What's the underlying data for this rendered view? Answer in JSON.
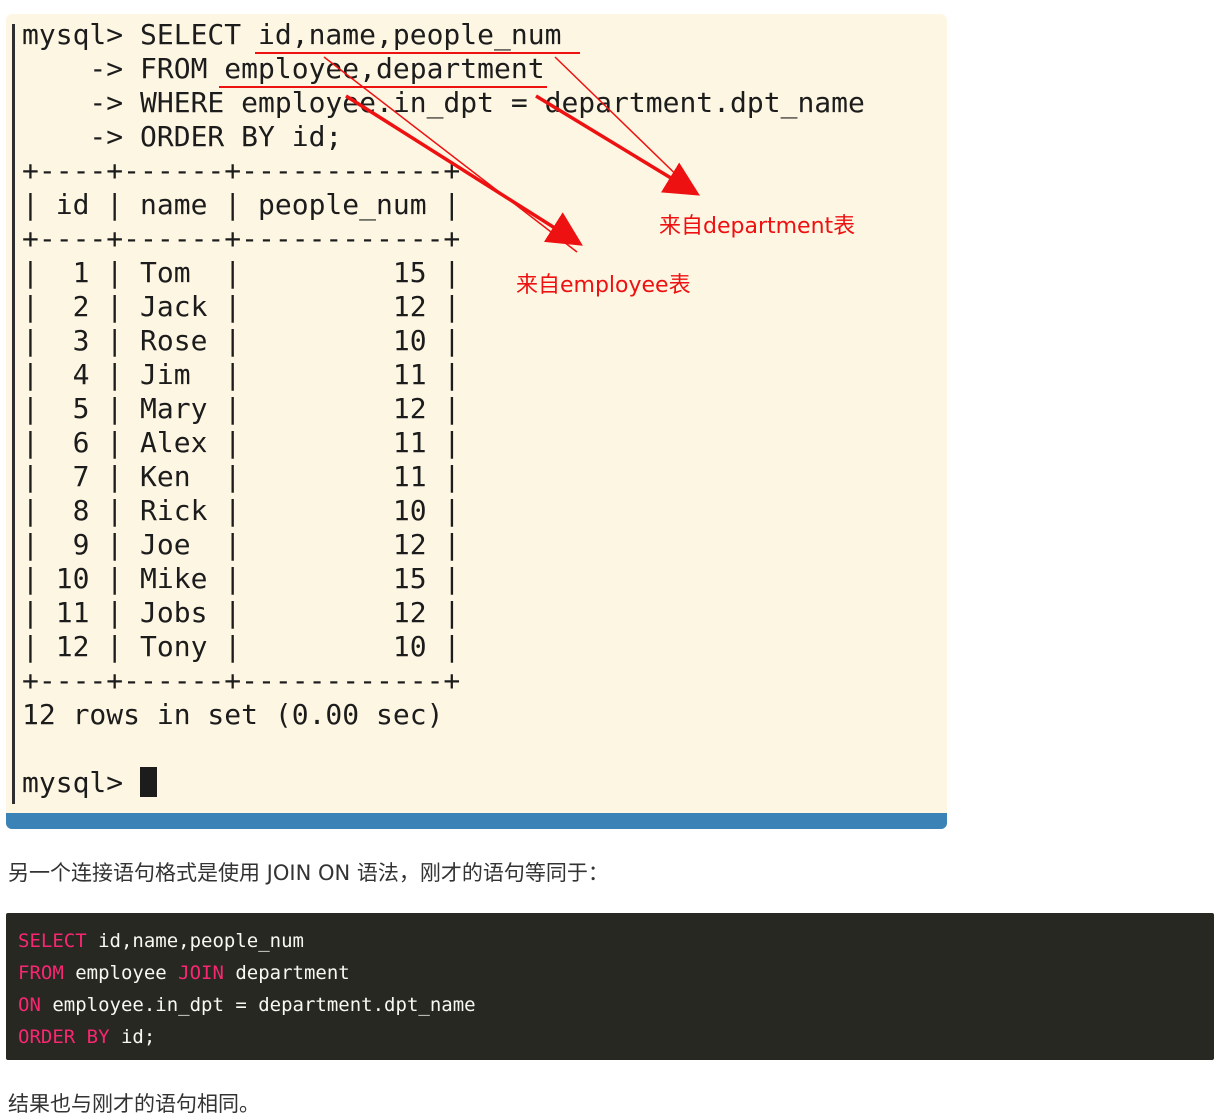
{
  "terminal": {
    "sql_lines": [
      "mysql> SELECT id,name,people_num",
      "    -> FROM employee,department",
      "    -> WHERE employee.in_dpt = department.dpt_name",
      "    -> ORDER BY id;"
    ],
    "table_border": "+----+------+------------+",
    "table_header": "| id | name | people_num |",
    "table_rows": [
      {
        "id": "1",
        "name": "Tom",
        "people_num": "15"
      },
      {
        "id": "2",
        "name": "Jack",
        "people_num": "12"
      },
      {
        "id": "3",
        "name": "Rose",
        "people_num": "10"
      },
      {
        "id": "4",
        "name": "Jim",
        "people_num": "11"
      },
      {
        "id": "5",
        "name": "Mary",
        "people_num": "12"
      },
      {
        "id": "6",
        "name": "Alex",
        "people_num": "11"
      },
      {
        "id": "7",
        "name": "Ken",
        "people_num": "11"
      },
      {
        "id": "8",
        "name": "Rick",
        "people_num": "10"
      },
      {
        "id": "9",
        "name": "Joe",
        "people_num": "12"
      },
      {
        "id": "10",
        "name": "Mike",
        "people_num": "15"
      },
      {
        "id": "11",
        "name": "Jobs",
        "people_num": "12"
      },
      {
        "id": "12",
        "name": "Tony",
        "people_num": "10"
      }
    ],
    "result_summary": "12 rows in set (0.00 sec)",
    "prompt": "mysql> ",
    "background_color": "#fdf6e3",
    "status_strip_color": "#3b82b6"
  },
  "annotations": {
    "from_department": "来自department表",
    "from_employee": "来自employee表",
    "color": "#ee1111"
  },
  "paragraph_intro": "另一个连接语句格式是使用 JOIN ON 语法，刚才的语句等同于：",
  "code_block": {
    "lines": [
      [
        {
          "t": "SELECT",
          "kw": true
        },
        {
          "t": " id,name,people_num",
          "kw": false
        }
      ],
      [
        {
          "t": "FROM",
          "kw": true
        },
        {
          "t": " employee ",
          "kw": false
        },
        {
          "t": "JOIN",
          "kw": true
        },
        {
          "t": " department",
          "kw": false
        }
      ],
      [
        {
          "t": "ON",
          "kw": true
        },
        {
          "t": " employee.in_dpt = department.dpt_name",
          "kw": false
        }
      ],
      [
        {
          "t": "ORDER BY",
          "kw": true
        },
        {
          "t": " id;",
          "kw": false
        }
      ]
    ],
    "background_color": "#272822",
    "keyword_color": "#f92672"
  },
  "paragraph_result": "结果也与刚才的语句相同。"
}
